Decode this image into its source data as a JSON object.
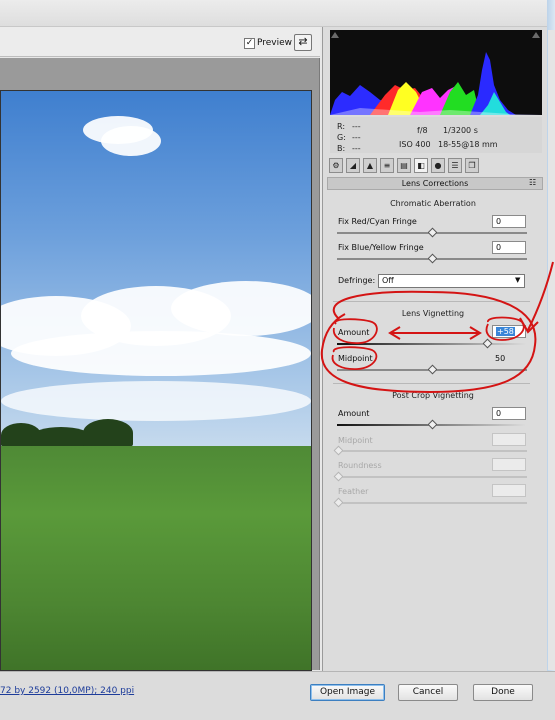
{
  "toolbar": {
    "preview_checked": "✓",
    "preview_label": "Preview",
    "fullscreen_icon": "fullscreen-toggle-icon",
    "fullscreen_glyph": "⇄"
  },
  "readout": {
    "r_label": "R:",
    "g_label": "G:",
    "b_label": "B:",
    "r_value": "---",
    "g_value": "---",
    "b_value": "---",
    "aperture": "f/8",
    "shutter": "1/3200 s",
    "iso": "ISO 400",
    "lens": "18-55@18 mm"
  },
  "tabs": [
    {
      "icon": "basic-icon",
      "glyph": "⚙"
    },
    {
      "icon": "tone-curve-icon",
      "glyph": "◢"
    },
    {
      "icon": "detail-icon",
      "glyph": "▲"
    },
    {
      "icon": "hsl-icon",
      "glyph": "≡"
    },
    {
      "icon": "split-toning-icon",
      "glyph": "▤"
    },
    {
      "icon": "lens-corrections-icon",
      "glyph": "◧"
    },
    {
      "icon": "camera-calibration-icon",
      "glyph": "●"
    },
    {
      "icon": "presets-icon",
      "glyph": "☰"
    },
    {
      "icon": "snapshots-icon",
      "glyph": "❐"
    }
  ],
  "panel": {
    "title": "Lens Corrections",
    "menu_glyph": "☷",
    "chromatic_aberration": {
      "heading": "Chromatic Aberration",
      "red_cyan_label": "Fix Red/Cyan Fringe",
      "red_cyan_value": "0",
      "blue_yellow_label": "Fix Blue/Yellow Fringe",
      "blue_yellow_value": "0",
      "defringe_label": "Defringe:",
      "defringe_value": "Off",
      "defringe_arrow": "▼"
    },
    "lens_vignetting": {
      "heading": "Lens Vignetting",
      "amount_label": "Amount",
      "amount_value": "+58",
      "midpoint_label": "Midpoint",
      "midpoint_value": "50"
    },
    "post_crop_vignetting": {
      "heading": "Post Crop Vignetting",
      "amount_label": "Amount",
      "amount_value": "0",
      "midpoint_label": "Midpoint",
      "roundness_label": "Roundness",
      "feather_label": "Feather"
    }
  },
  "status": {
    "workflow_text": "72 by 2592 (10,0MP); 240 ppi"
  },
  "buttons": {
    "open": "Open Image",
    "cancel": "Cancel",
    "done": "Done"
  },
  "colors": {
    "annotation": "#d41414",
    "value_highlight": "#3a86d8"
  }
}
